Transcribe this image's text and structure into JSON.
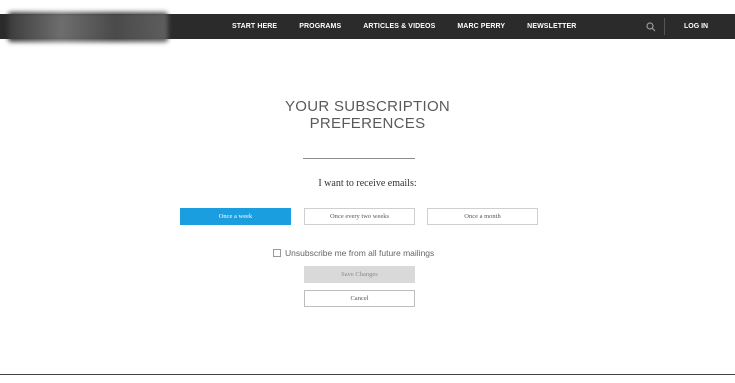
{
  "header": {
    "nav": [
      "START HERE",
      "PROGRAMS",
      "ARTICLES & VIDEOS",
      "MARC PERRY",
      "NEWSLETTER"
    ],
    "login_label": "LOG IN",
    "search_icon": "search-icon",
    "colors": {
      "bar": "#2b2b2b",
      "text": "#ffffff"
    }
  },
  "main": {
    "title_line1": "YOUR SUBSCRIPTION",
    "title_line2": "PREFERENCES",
    "prompt": "I want to receive emails:",
    "frequency_options": [
      {
        "label": "Once a week",
        "selected": true
      },
      {
        "label": "Once every two weeks",
        "selected": false
      },
      {
        "label": "Once a month",
        "selected": false
      }
    ],
    "unsubscribe_label": "Unsubscribe me from all future mailings",
    "unsubscribe_checked": false,
    "save_label": "Save Changes",
    "cancel_label": "Cancel",
    "colors": {
      "accent": "#1a9ee0",
      "save_disabled": "#d9d9d9"
    }
  }
}
